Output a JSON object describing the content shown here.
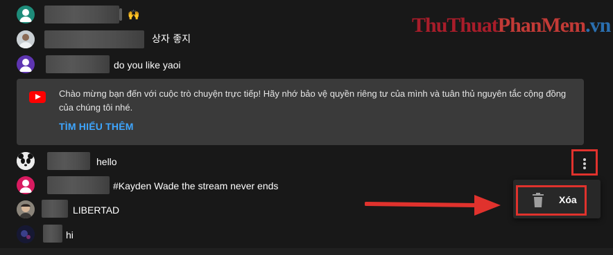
{
  "watermark": {
    "part1": "ThuThuat",
    "part2": "PhanMem",
    "part3": ".vn"
  },
  "chat": {
    "messages": [
      {
        "text": "🙌",
        "avatar": "teal-person-avatar"
      },
      {
        "text": "상자 좋지",
        "avatar": "photo-avatar"
      },
      {
        "text": "do you like yaoi",
        "avatar": "purple-person-avatar"
      },
      {
        "text": "hello",
        "avatar": "panda-avatar"
      },
      {
        "text": "#Kayden Wade the stream never ends",
        "avatar": "pink-person-avatar"
      },
      {
        "text": "LIBERTAD",
        "avatar": "photo-avatar"
      },
      {
        "text": "hi",
        "avatar": "dark-photo-avatar"
      }
    ]
  },
  "banner": {
    "text": "Chào mừng bạn đến với cuộc trò chuyện trực tiếp! Hãy nhớ bảo vệ quyền riêng tư của mình và tuân thủ nguyên tắc cộng đồng của chúng tôi nhé.",
    "link": "TÌM HIỂU THÊM",
    "icon": "youtube-icon"
  },
  "context_menu": {
    "delete_label": "Xóa",
    "icon": "trash-icon",
    "trigger_icon": "more-vertical-icon"
  },
  "colors": {
    "background": "#181818",
    "banner": "#3a3a3a",
    "link": "#3ea6ff",
    "highlight": "#e0322d",
    "popup": "#282828"
  }
}
